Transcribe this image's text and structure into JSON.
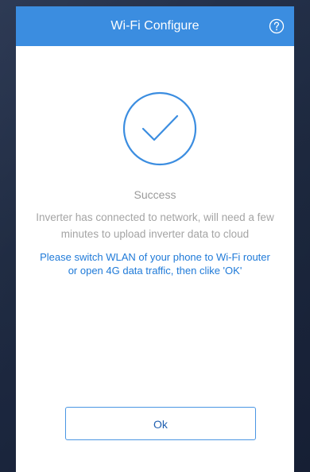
{
  "header": {
    "title": "Wi-Fi Configure",
    "help_icon": "question-circle-icon"
  },
  "main": {
    "status_icon": "check-circle-icon",
    "status": "Success",
    "description": "Inverter has connected to network, will need a few minutes to upload inverter data to cloud",
    "instruction": "Please switch WLAN of your phone to Wi-Fi router or open 4G data traffic, then clike 'OK'",
    "ok_label": "Ok"
  },
  "colors": {
    "header_bg": "#3b8de0",
    "accent": "#1f7ad8",
    "muted_text": "#a4a4a4",
    "page_bg": "#1e2a41"
  }
}
